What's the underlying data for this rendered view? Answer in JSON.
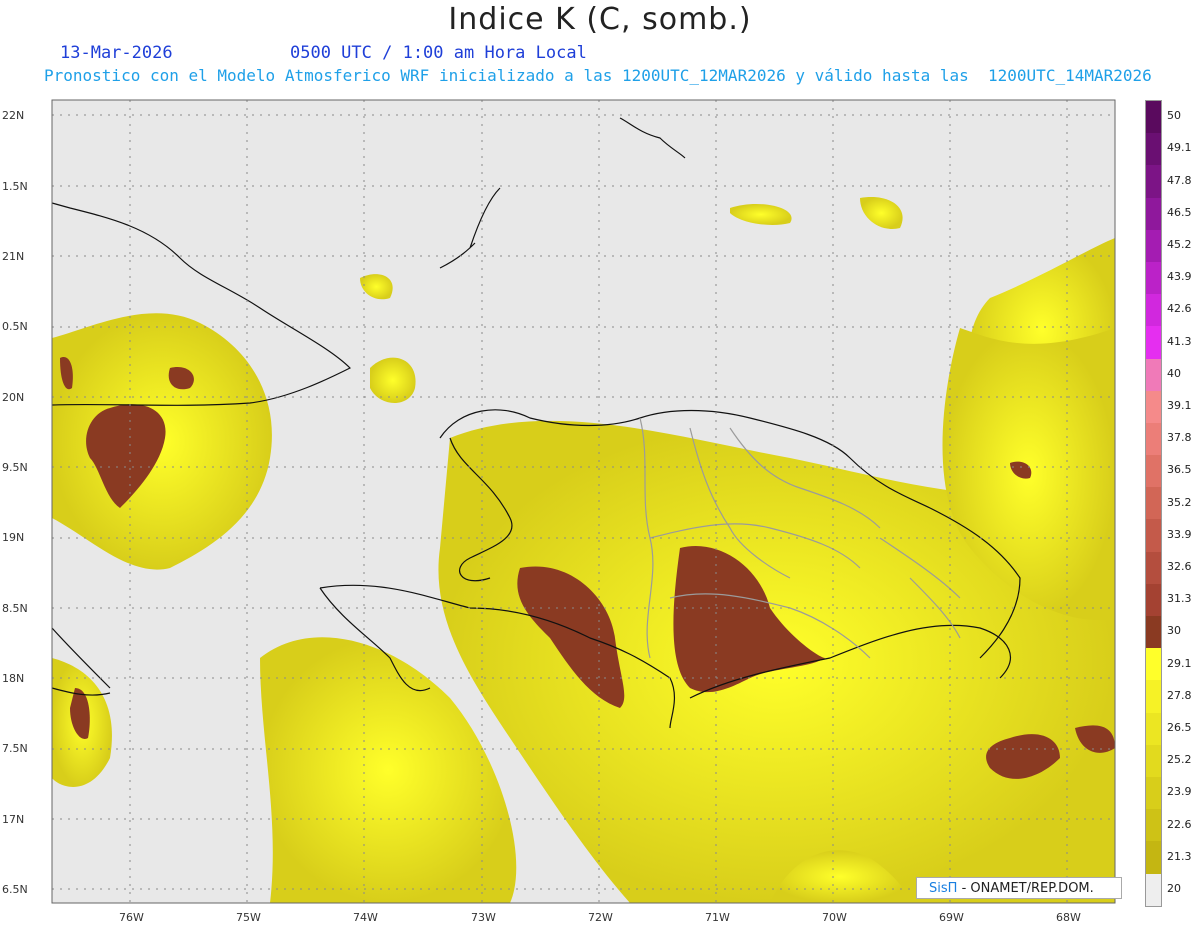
{
  "title": "Indice K (C, somb.)",
  "date": "13-Mar-2026",
  "time": "0500 UTC / 1:00 am Hora Local",
  "forecast": "Pronostico con el Modelo Atmosferico WRF inicializado a las 1200UTC_12MAR2026 y válido hasta las  1200UTC_14MAR2026",
  "lat_labels": [
    "22N",
    "1.5N",
    "21N",
    "0.5N",
    "20N",
    "9.5N",
    "19N",
    "8.5N",
    "18N",
    "7.5N",
    "17N",
    "6.5N"
  ],
  "lon_labels": [
    "76W",
    "75W",
    "74W",
    "73W",
    "72W",
    "71W",
    "70W",
    "69W",
    "68W"
  ],
  "colorbar": {
    "labels": [
      "50",
      "49.1",
      "47.8",
      "46.5",
      "45.2",
      "43.9",
      "42.6",
      "41.3",
      "40",
      "39.1",
      "37.8",
      "36.5",
      "35.2",
      "33.9",
      "32.6",
      "31.3",
      "30",
      "29.1",
      "27.8",
      "26.5",
      "25.2",
      "23.9",
      "22.6",
      "21.3",
      "20"
    ],
    "colors": [
      "#5a0a5e",
      "#6a0f72",
      "#7c1486",
      "#8f189c",
      "#a41cb2",
      "#bb22c8",
      "#d128de",
      "#e52ef0",
      "#f07ab8",
      "#f58a8a",
      "#ec7e78",
      "#e07266",
      "#d26656",
      "#c45a4a",
      "#b44e3e",
      "#a44232",
      "#8a3a22",
      "#ffff2a",
      "#f6f226",
      "#ece622",
      "#e2da1e",
      "#d8ce1a",
      "#cec216",
      "#c4b612",
      "#eeeeee"
    ]
  },
  "credit": {
    "brand": "SisΠ",
    "org": "- ONAMET/REP.DOM."
  }
}
